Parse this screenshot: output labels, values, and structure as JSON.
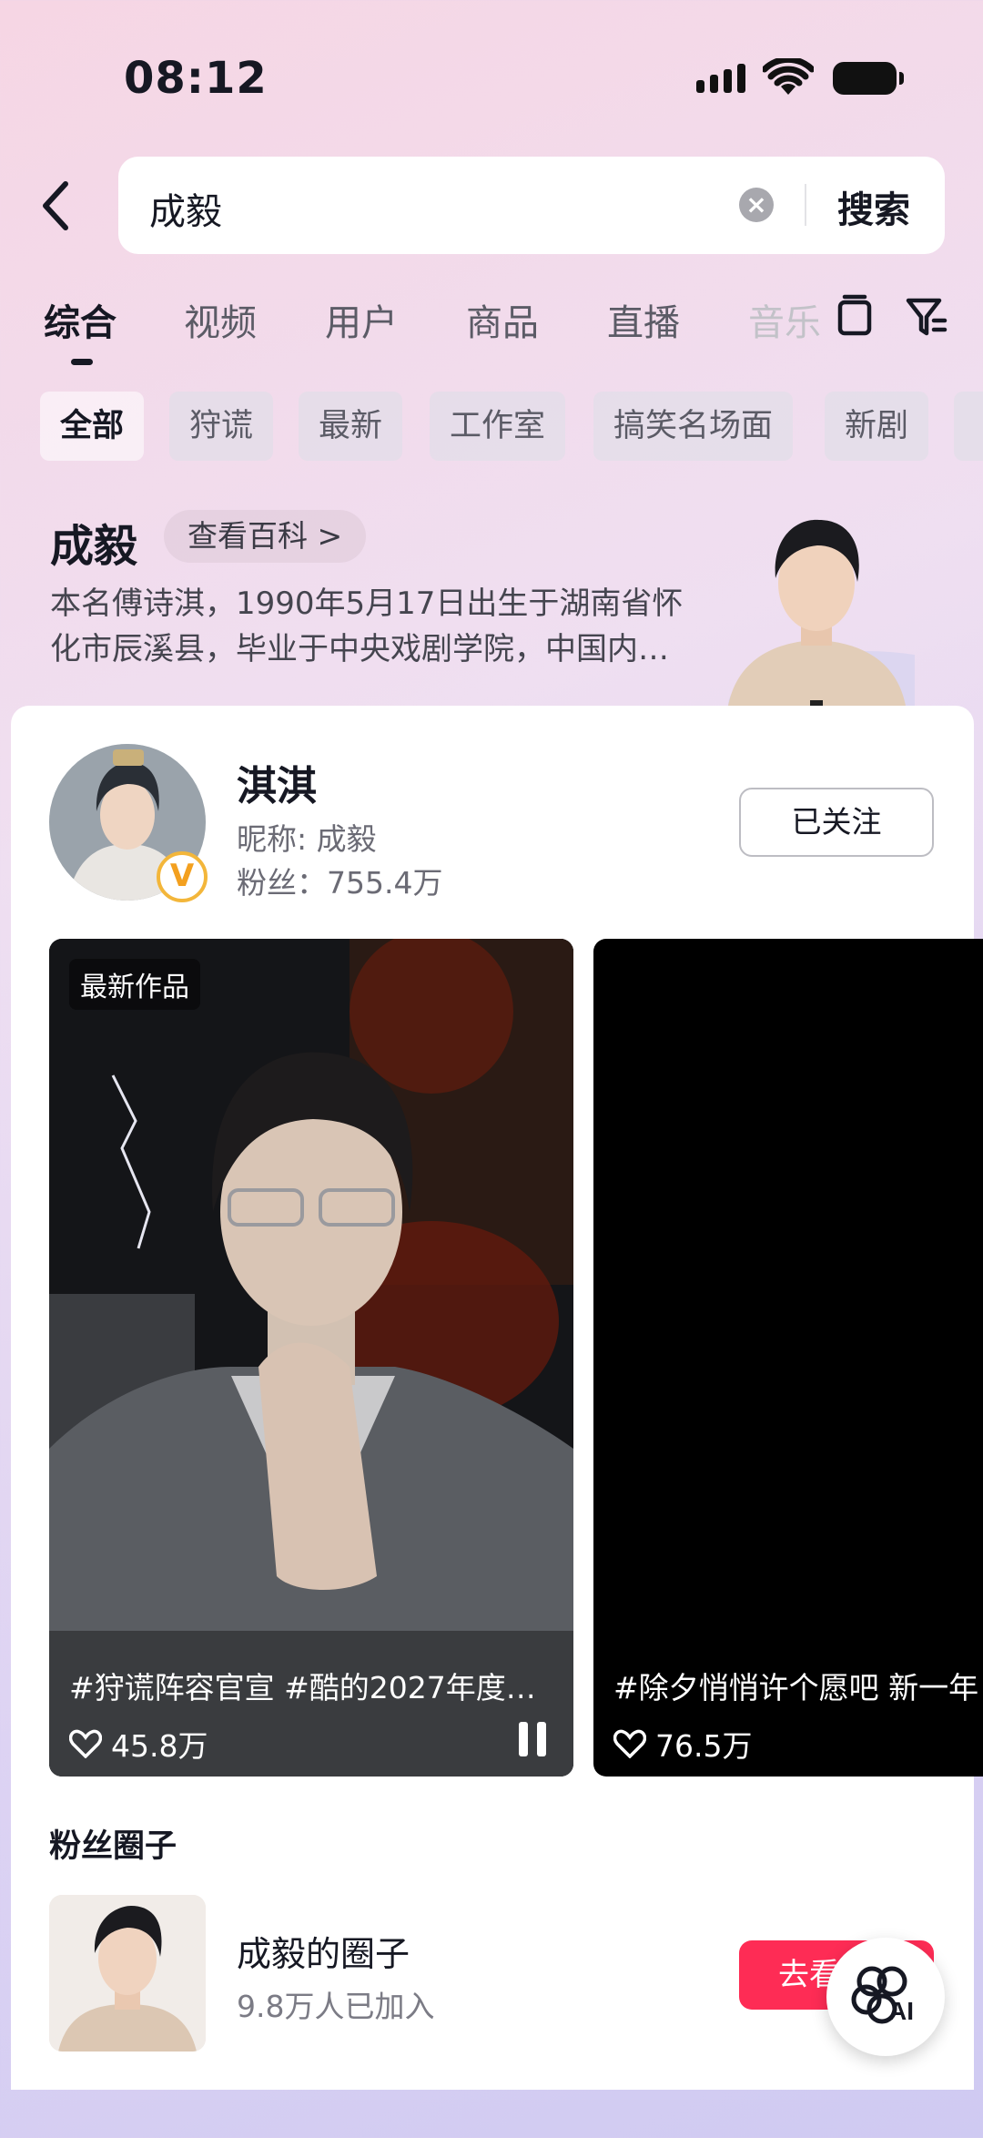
{
  "status": {
    "time": "08:12"
  },
  "search": {
    "query": "成毅",
    "button": "搜索"
  },
  "tabs": [
    "综合",
    "视频",
    "用户",
    "商品",
    "直播",
    "音乐"
  ],
  "chips": [
    "全部",
    "狩谎",
    "最新",
    "工作室",
    "搞笑名场面",
    "新剧"
  ],
  "baike": {
    "name": "成毅",
    "button": "查看百科 >",
    "desc": "本名傅诗淇，1990年5月17日出生于湖南省怀化市辰溪县，毕业于中央戏剧学院，中国内…"
  },
  "user": {
    "name": "淇淇",
    "nickname": "昵称: 成毅",
    "fans": "粉丝：755.4万",
    "follow": "已关注"
  },
  "videos": [
    {
      "tag": "最新作品",
      "caption": "#狩谎阵容官宣 #酷的2027年度…",
      "likes": "45.8万"
    },
    {
      "caption": "#除夕悄悄许个愿吧 新一年",
      "likes": "76.5万"
    }
  ],
  "fan_circle": {
    "title": "粉丝圈子",
    "name": "成毅的圈子",
    "count": "9.8万人已加入",
    "button": "去看看"
  },
  "colors": {
    "accent": "#fe2c55",
    "badge": "#f3b63a"
  }
}
